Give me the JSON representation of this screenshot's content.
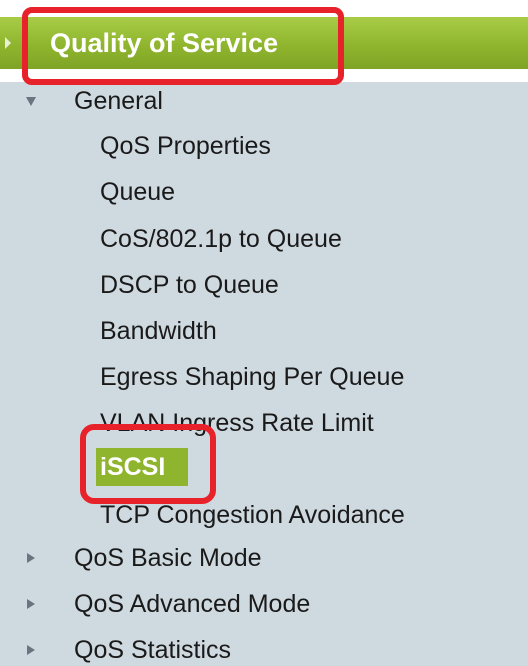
{
  "header": {
    "title": "Quality of Service"
  },
  "groups": {
    "general": {
      "label": "General",
      "items": [
        "QoS Properties",
        "Queue",
        "CoS/802.1p to Queue",
        "DSCP to Queue",
        "Bandwidth",
        "Egress Shaping Per Queue",
        "VLAN Ingress Rate Limit",
        "iSCSI",
        "TCP Congestion Avoidance"
      ]
    },
    "basic": {
      "label": "QoS Basic Mode"
    },
    "advanced": {
      "label": "QoS Advanced Mode"
    },
    "statistics": {
      "label": "QoS Statistics"
    }
  },
  "selected_item": "iSCSI",
  "colors": {
    "header_green": "#8fb52e",
    "panel_bg": "#cfd9e0",
    "highlight_red": "#e8222a"
  }
}
